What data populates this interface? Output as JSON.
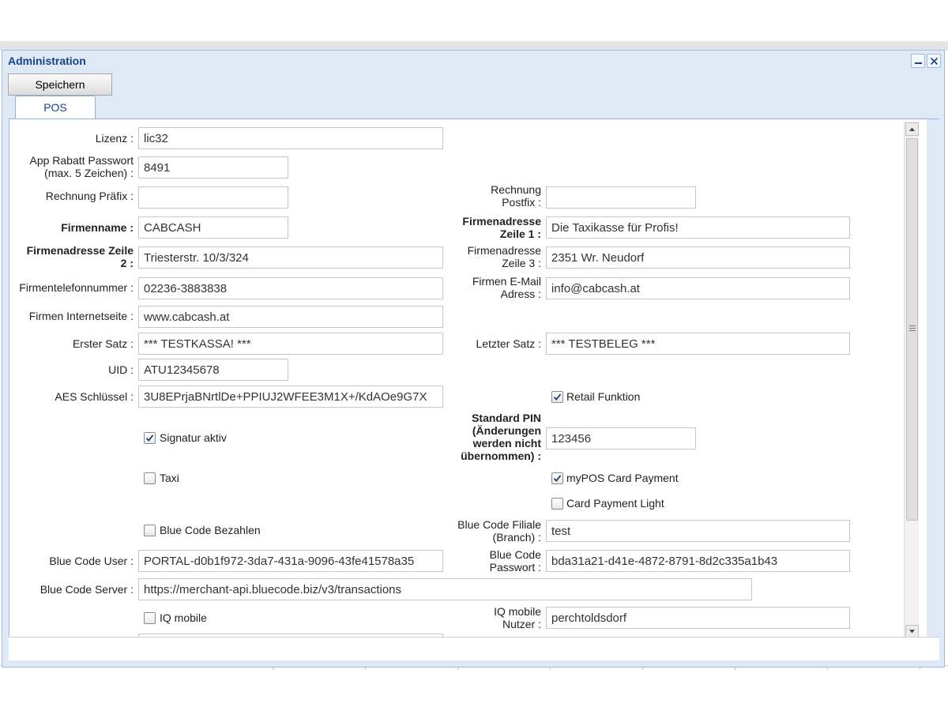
{
  "window": {
    "title": "Administration"
  },
  "toolbar": {
    "save_label": "Speichern"
  },
  "tabs": [
    {
      "label": "POS"
    }
  ],
  "form": {
    "lizenz": {
      "label": "Lizenz :",
      "value": "lic32"
    },
    "app_rabatt": {
      "label_line1": "App Rabatt Passwort",
      "label_line2": "(max. 5 Zeichen) :",
      "value": "8491"
    },
    "rechnung_praefix": {
      "label": "Rechnung Präfix :",
      "value": ""
    },
    "rechnung_postfix": {
      "label_line1": "Rechnung",
      "label_line2": "Postfix :",
      "value": ""
    },
    "firmenname": {
      "label": "Firmenname :",
      "value": "CABCASH"
    },
    "firmenadresse1": {
      "label_line1": "Firmenadresse",
      "label_line2": "Zeile 1 :",
      "value": "Die Taxikasse für Profis!"
    },
    "firmenadresse2": {
      "label_line1": "Firmenadresse Zeile",
      "label_line2": "2 :",
      "value": "Triesterstr. 10/3/324"
    },
    "firmenadresse3": {
      "label_line1": "Firmenadresse",
      "label_line2": "Zeile 3 :",
      "value": "2351 Wr. Neudorf"
    },
    "firmentelefon": {
      "label": "Firmentelefonnummer :",
      "value": "02236-3883838"
    },
    "firmen_email": {
      "label_line1": "Firmen E-Mail",
      "label_line2": "Adress :",
      "value": "info@cabcash.at"
    },
    "internetseite": {
      "label": "Firmen Internetseite :",
      "value": "www.cabcash.at"
    },
    "erster_satz": {
      "label": "Erster Satz :",
      "value": "*** TESTKASSA! ***"
    },
    "letzter_satz": {
      "label": "Letzter Satz :",
      "value": "*** TESTBELEG ***"
    },
    "uid": {
      "label": "UID :",
      "value": "ATU12345678"
    },
    "aes": {
      "label": "AES Schlüssel :",
      "value": "3U8EPrjaBNrtlDe+PPIUJ2WFEE3M1X+/KdAOe9G7X"
    },
    "retail_funktion": {
      "label": "Retail Funktion",
      "checked": true
    },
    "signatur_aktiv": {
      "label": "Signatur aktiv",
      "checked": true
    },
    "standard_pin": {
      "label_line1": "Standard PIN",
      "label_line2": "(Änderungen",
      "label_line3": "werden nicht",
      "label_line4": "übernommen) :",
      "value": "123456"
    },
    "taxi": {
      "label": "Taxi",
      "checked": false
    },
    "mypos_card": {
      "label": "myPOS Card Payment",
      "checked": true
    },
    "card_payment_light": {
      "label": "Card Payment Light",
      "checked": false
    },
    "blue_code_bezahlen": {
      "label": "Blue Code Bezahlen",
      "checked": false
    },
    "blue_code_filiale": {
      "label_line1": "Blue Code Filiale",
      "label_line2": "(Branch) :",
      "value": "test"
    },
    "blue_code_user": {
      "label": "Blue Code User :",
      "value": "PORTAL-d0b1f972-3da7-431a-9096-43fe41578a35"
    },
    "blue_code_passwort": {
      "label_line1": "Blue Code",
      "label_line2": "Passwort :",
      "value": "bda31a21-d41e-4872-8791-8d2c335a1b43"
    },
    "blue_code_server": {
      "label": "Blue Code Server :",
      "value": "https://merchant-api.bluecode.biz/v3/transactions"
    },
    "iq_mobile": {
      "label": "IQ mobile",
      "checked": false
    },
    "iq_mobile_nutzer": {
      "label_line1": "IQ mobile",
      "label_line2": "Nutzer :",
      "value": "perchtoldsdorf"
    }
  },
  "icons": {
    "minimize": "minimize-icon",
    "close": "close-icon",
    "check": "checkmark-icon"
  },
  "colors": {
    "title": "#15428b",
    "window_border": "#99bbe8",
    "window_bg": "#dfe9f5",
    "tab_border": "#8db2e3"
  }
}
